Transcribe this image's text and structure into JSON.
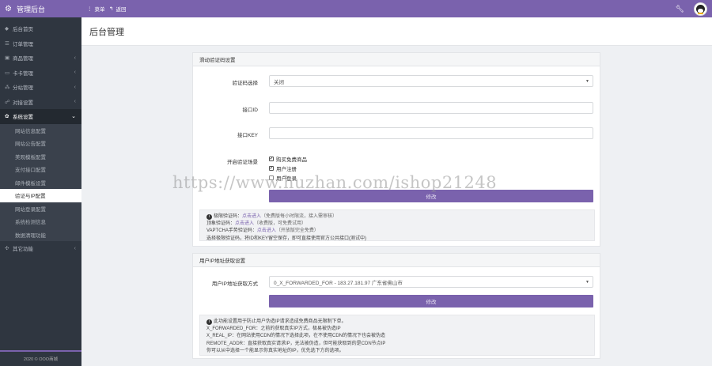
{
  "topbar": {
    "brand": "管理后台",
    "menu_label": "菜单",
    "back_label": "返回"
  },
  "sidebar": {
    "items": [
      {
        "icon": "dashboard-icon",
        "label": "后台首页"
      },
      {
        "icon": "list-icon",
        "label": "订单管理"
      },
      {
        "icon": "box-icon",
        "label": "商品管理"
      },
      {
        "icon": "card-icon",
        "label": "卡卡管理"
      },
      {
        "icon": "share-icon",
        "label": "分站管理"
      },
      {
        "icon": "users-icon",
        "label": "对接设置"
      },
      {
        "icon": "gear-icon",
        "label": "系统设置"
      }
    ],
    "subitems": [
      "网站信息配置",
      "网站公告配置",
      "美观模板配置",
      "支付接口配置",
      "邮件模板设置",
      "验证与IP配置",
      "网站登录配置",
      "系统检测信息",
      "数据清理功能"
    ],
    "last_item": {
      "icon": "extension-icon",
      "label": "其它功能"
    },
    "footer": "2020 © OOO商城"
  },
  "page": {
    "title": "后台管理"
  },
  "captcha_panel": {
    "title": "滑动验证码设置",
    "select_label": "验证码选择",
    "select_value": "关闭",
    "id_label": "接口ID",
    "id_value": "",
    "key_label": "接口KEY",
    "key_value": "",
    "scenes_label": "开启验证场景",
    "scenes": [
      {
        "label": "购买免费商品",
        "checked": true
      },
      {
        "label": "用户注册",
        "checked": true
      },
      {
        "label": "用户登录",
        "checked": false
      }
    ],
    "save_label": "修改",
    "help": {
      "line1_prefix": "极限验证码：",
      "line1_link": "点击进入",
      "line1_suffix": "（免费版每小时限流，接入需审核）",
      "line2_prefix": "顶象验证码：",
      "line2_link": "点击进入",
      "line2_suffix": "（收费版，可免费试用）",
      "line3_prefix": "VAPTCHA手势验证码：",
      "line3_link": "点击进入",
      "line3_suffix": "（开放版完全免费）",
      "line4": "选择极限验证码，将ID和KEY留空保存，即可直接使用官方公共接口(测试中)"
    }
  },
  "ip_panel": {
    "title": "用户IP地址获取设置",
    "select_label": "用户IP地址获取方式",
    "select_value": "0_X_FORWARDED_FOR - 183.27.181.97 广东省佛山市",
    "save_label": "修改",
    "help": {
      "line1": "此功能设置用于防止用户伪造IP请求造成免费商品无限制下单。",
      "line2": "X_FORWARDED_FOR：之前的获取真实IP方式，极易被伪造IP",
      "line3": "X_REAL_IP：在网站使用CDN的情况下选择此项，在不使用CDN的情况下也会被伪造",
      "line4": "REMOTE_ADDR：直接获取真实请求IP，无法被伪造，但可能获取到的是CDN节点IP",
      "line5": "你可以从中选择一个能显示你真实地址的IP，优先选下方的选项。"
    }
  },
  "watermark": "https://www.huzhan.com/ishop21248",
  "colors": {
    "accent": "#7a62ad",
    "sidebar_bg": "#2f3640"
  }
}
